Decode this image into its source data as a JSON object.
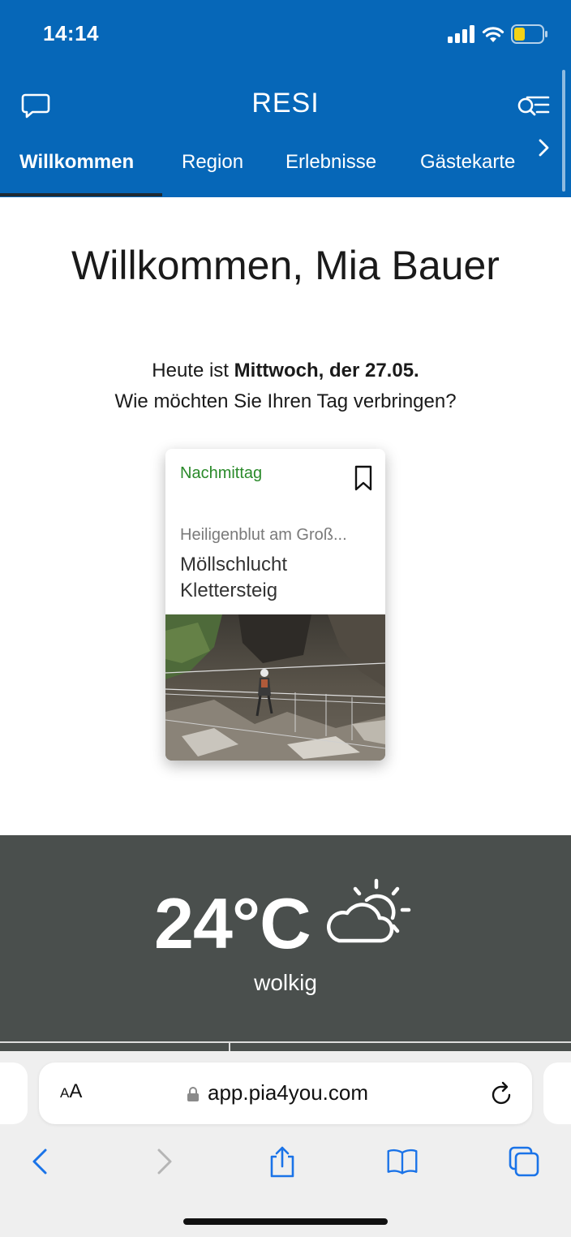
{
  "status_bar": {
    "time": "14:14"
  },
  "header": {
    "title": "RESI",
    "chat_icon": "chat-bubble-icon",
    "search_icon": "search-list-icon"
  },
  "tabs": [
    {
      "label": "Willkommen",
      "active": true
    },
    {
      "label": "Region",
      "active": false
    },
    {
      "label": "Erlebnisse",
      "active": false
    },
    {
      "label": "Gästekarte",
      "active": false
    }
  ],
  "welcome": {
    "title": "Willkommen, Mia Bauer",
    "line1_prefix": "Heute ist ",
    "line1_emphasis": "Mittwoch, der 27.05.",
    "line2": "Wie möchten Sie Ihren Tag verbringen?"
  },
  "card": {
    "time_of_day": "Nachmittag",
    "location": "Heiligenblut am Groß...",
    "name": "Möllschlucht Klettersteig",
    "bookmark_icon": "bookmark-icon"
  },
  "weather": {
    "temperature": "24°C",
    "description": "wolkig",
    "icon": "partly-cloudy-icon"
  },
  "browser": {
    "text_size_label_big": "A",
    "text_size_label_small": "A",
    "url": "app.pia4you.com"
  },
  "colors": {
    "brand_blue": "#0667b8",
    "weather_bg": "#4a4f4d",
    "accent_green": "#2a8a2a"
  }
}
